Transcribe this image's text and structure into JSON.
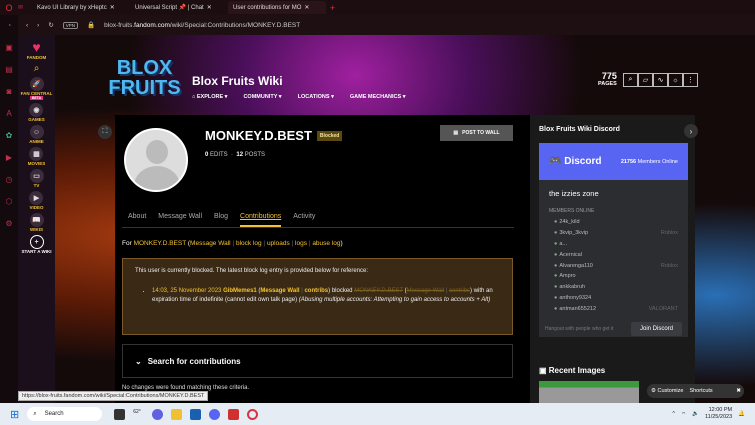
{
  "browser": {
    "tabs": [
      {
        "title": "Kavo UI Library by xHeptc"
      },
      {
        "title": "Universal Script 📌 | Chat"
      },
      {
        "title": "User contributions for MO"
      }
    ],
    "url_prefix": "blox-fruits.",
    "url_domain": "fandom.com",
    "url_path": "/wiki/Special:Contributions/MONKEY.D.BEST",
    "vpn": "VPN",
    "status_url": "https://blox-fruits.fandom.com/wiki/Special:Contributions/MONKEY.D.BEST"
  },
  "fandom_nav": {
    "items": [
      "FANDOM",
      "FAN CENTRAL",
      "GAMES",
      "ANIME",
      "MOVIES",
      "TV",
      "VIDEO",
      "WIKIS",
      "START A WIKI"
    ],
    "beta": "BETA"
  },
  "wiki": {
    "logo": "BLOX FRUITS",
    "title": "Blox Fruits Wiki",
    "nav": [
      "EXPLORE",
      "COMMUNITY",
      "LOCATIONS",
      "GAME MECHANICS"
    ],
    "pages_count": "775",
    "pages_label": "PAGES"
  },
  "profile": {
    "username": "MONKEY.D.BEST",
    "badge": "Blocked",
    "edits": "0",
    "edits_label": "EDITS",
    "posts": "12",
    "posts_label": "POSTS",
    "post_button": "POST TO WALL"
  },
  "tabs": [
    "About",
    "Message Wall",
    "Blog",
    "Contributions",
    "Activity"
  ],
  "for_line": {
    "prefix": "For",
    "user": "MONKEY.D.BEST",
    "links": [
      "Message Wall",
      "block log",
      "uploads",
      "logs",
      "abuse log"
    ]
  },
  "block_notice": {
    "intro": "This user is currently blocked. The latest block log entry is provided below for reference:",
    "time": "14:03, 25 November 2023",
    "admin": "GibMemes1",
    "admin_wall": "Message Wall",
    "admin_contribs": "contribs",
    "verb": "blocked",
    "target": "MONKEY.D.BEST",
    "target_wall": "Message Wall",
    "target_contribs": "contribs",
    "rest": "with an expiration time of indefinite (cannot edit own talk page)",
    "reason": "(Abusing multiple accounts: Attempting to gain access to accounts + Alt)"
  },
  "search_contrib": "Search for contributions",
  "no_changes": "No changes were found matching these criteria.",
  "rail": {
    "title": "Blox Fruits Wiki Discord",
    "discord": "Discord",
    "members_count": "21756",
    "members_label": "Members Online",
    "server": "the izzies zone",
    "members_online": "MEMBERS ONLINE",
    "members": [
      {
        "name": "24k_kild",
        "game": ""
      },
      {
        "name": "3kvip_3kvip",
        "game": "Roblox"
      },
      {
        "name": "a...",
        "game": ""
      },
      {
        "name": "Acernical",
        "game": ""
      },
      {
        "name": "Alvarenga110",
        "game": "Roblox"
      },
      {
        "name": "Ampro",
        "game": ""
      },
      {
        "name": "ankkabruh",
        "game": ""
      },
      {
        "name": "anthony9324",
        "game": ""
      },
      {
        "name": "antman655212",
        "game": "VALORANT"
      }
    ],
    "footer": "Hangout with people who get it",
    "join": "Join Discord",
    "recent_images": "Recent Images"
  },
  "customize": {
    "customize": "Customize",
    "shortcuts": "Shortcuts"
  },
  "taskbar": {
    "search": "Search",
    "weather": "62°",
    "time": "12:00 PM",
    "date": "11/25/2023"
  }
}
